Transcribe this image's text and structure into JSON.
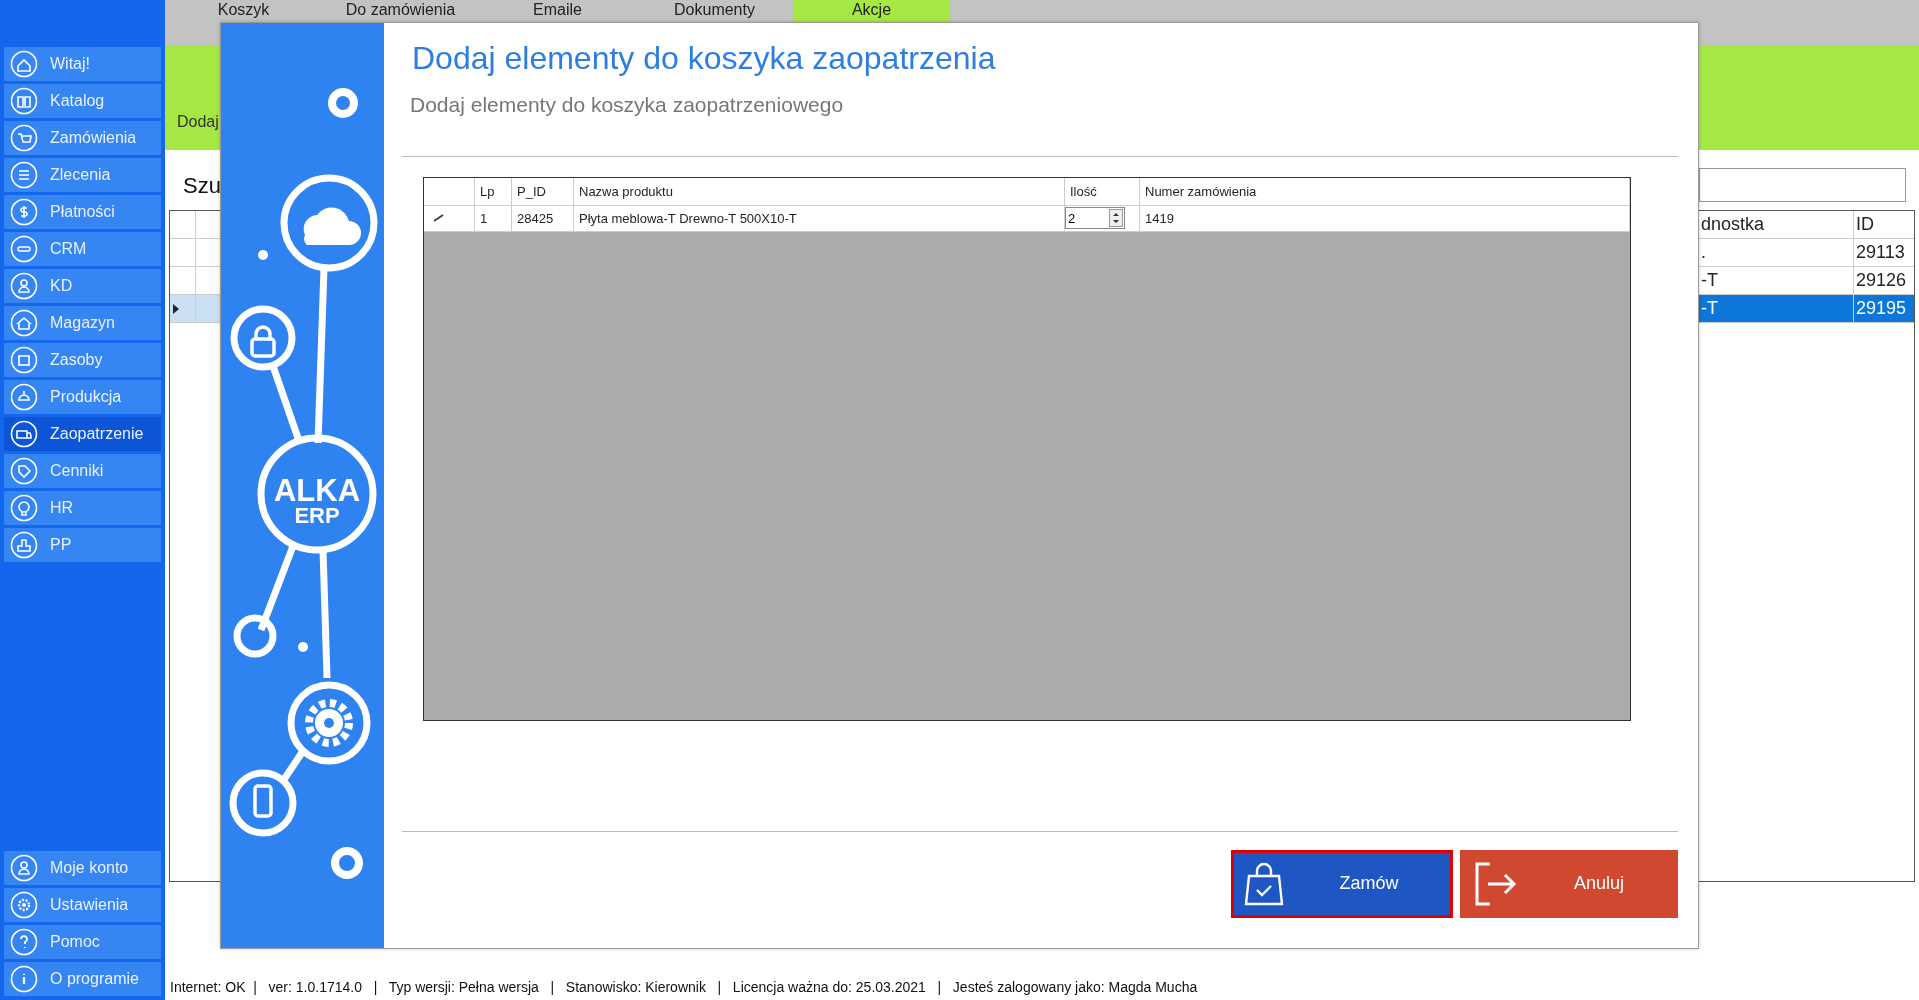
{
  "sidebar": {
    "items": [
      {
        "label": "Witaj!",
        "selected": false
      },
      {
        "label": "Katalog",
        "selected": false
      },
      {
        "label": "Zamówienia",
        "selected": false
      },
      {
        "label": "Zlecenia",
        "selected": false
      },
      {
        "label": "Płatności",
        "selected": false
      },
      {
        "label": "CRM",
        "selected": false
      },
      {
        "label": "KD",
        "selected": false
      },
      {
        "label": "Magazyn",
        "selected": false
      },
      {
        "label": "Zasoby",
        "selected": false
      },
      {
        "label": "Produkcja",
        "selected": false
      },
      {
        "label": "Zaopatrzenie",
        "selected": true
      },
      {
        "label": "Cenniki",
        "selected": false
      },
      {
        "label": "HR",
        "selected": false
      },
      {
        "label": "PP",
        "selected": false
      }
    ],
    "bottom_items": [
      {
        "label": "Moje konto"
      },
      {
        "label": "Ustawienia"
      },
      {
        "label": "Pomoc"
      },
      {
        "label": "O programie"
      }
    ]
  },
  "top_tabs": [
    {
      "label": "Koszyk",
      "selected": false
    },
    {
      "label": "Do zamówienia",
      "selected": false
    },
    {
      "label": "Emaile",
      "selected": false
    },
    {
      "label": "Dokumenty",
      "selected": false
    },
    {
      "label": "Akcje",
      "selected": true
    }
  ],
  "page": {
    "breadcrumb": "Dodaj",
    "heading": "Szu",
    "table": {
      "columns": [
        "dnostka",
        "ID"
      ],
      "rows": [
        {
          "cells": [
            ".",
            "29113"
          ],
          "selected": false
        },
        {
          "cells": [
            "-T",
            "29126"
          ],
          "selected": false
        },
        {
          "cells": [
            "-T",
            "29195"
          ],
          "selected": true
        }
      ]
    }
  },
  "dialog": {
    "logo_lines": [
      "ALKA",
      "ERP"
    ],
    "title": "Dodaj elementy do koszyka zaopatrzenia",
    "subtitle": "Dodaj elementy do koszyka zaopatrzeniowego",
    "grid": {
      "columns": [
        "Lp",
        "P_ID",
        "Nazwa produktu",
        "Ilość",
        "Numer zamówienia"
      ],
      "rows": [
        {
          "lp": "1",
          "p_id": "28425",
          "name": "Płyta meblowa-T Drewno-T 500X10-T",
          "quantity": "2",
          "order_number": "1419",
          "editing": true
        }
      ]
    },
    "buttons": [
      {
        "label": "Zamów",
        "kind": "order",
        "focused": true
      },
      {
        "label": "Anuluj",
        "kind": "cancel",
        "focused": false
      }
    ]
  },
  "status_bar": {
    "text": "Internet: OK  |   ver: 1.0.1714.0   |   Typ wersji: Pełna wersja   |   Stanowisko: Kierownik   |   Licencja ważna do: 25.03.2021   |   Jesteś zalogowany jako: Magda Mucha"
  }
}
